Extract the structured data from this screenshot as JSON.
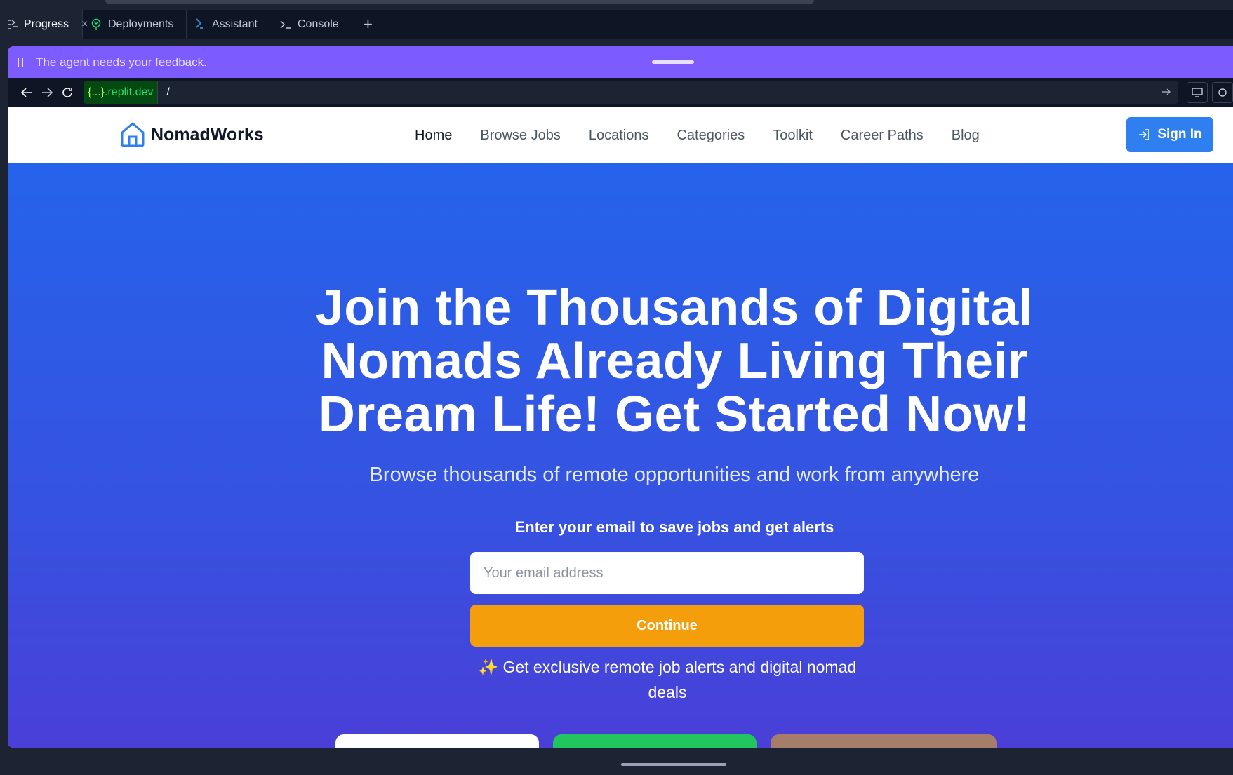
{
  "tabs": [
    {
      "label": "Progress",
      "icon": "progress-icon",
      "active": true,
      "closable": true
    },
    {
      "label": "Deployments",
      "icon": "deployments-icon"
    },
    {
      "label": "Assistant",
      "icon": "assistant-icon"
    },
    {
      "label": "Console",
      "icon": "console-icon"
    }
  ],
  "tab_add": "+",
  "tab_close": "×",
  "banner": {
    "text": "The agent needs your feedback."
  },
  "url": {
    "domain_braces": "{...}",
    "domain": ".replit.dev",
    "path": "/"
  },
  "site": {
    "brand": "NomadWorks",
    "nav": [
      "Home",
      "Browse Jobs",
      "Locations",
      "Categories",
      "Toolkit",
      "Career Paths",
      "Blog"
    ],
    "active_nav": "Home",
    "signin_label": "Sign In",
    "hero": {
      "title": "Join the Thousands of Digital Nomads Already Living Their Dream Life! Get Started Now!",
      "subtitle": "Browse thousands of remote opportunities and work from anywhere",
      "email_label": "Enter your email to save jobs and get alerts",
      "email_placeholder": "Your email address",
      "continue_label": "Continue",
      "perk_icon": "✨",
      "perk_text": "Get exclusive remote job alerts and digital nomad deals"
    }
  },
  "colors": {
    "banner": "#7c5cff",
    "brand_blue": "#2f7ff0",
    "hero_top": "#2563eb",
    "hero_bottom": "#4a3fd8",
    "continue": "#f59e0b"
  }
}
